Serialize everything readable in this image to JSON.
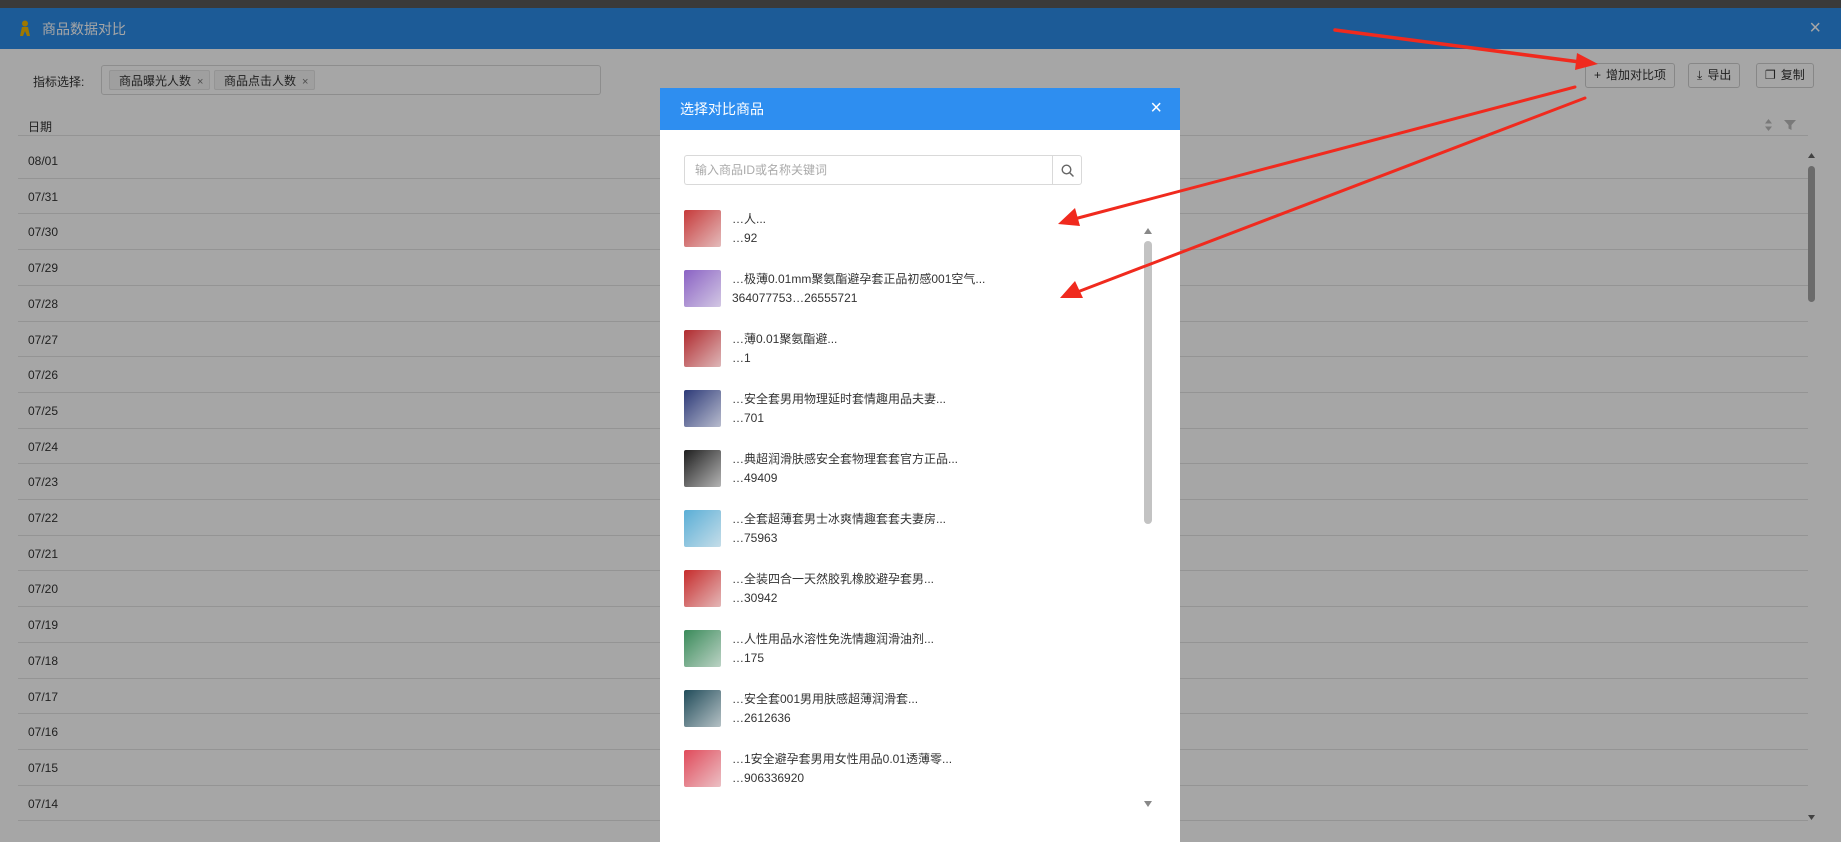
{
  "window": {
    "title": "商品数据对比"
  },
  "filter": {
    "label": "指标选择:",
    "tags": [
      {
        "label": "商品曝光人数",
        "remove": "×"
      },
      {
        "label": "商品点击人数",
        "remove": "×"
      }
    ]
  },
  "toolbar": {
    "add_label": "增加对比项",
    "export_label": "导出",
    "copy_label": "复制"
  },
  "table": {
    "header_date": "日期",
    "dates": [
      "08/01",
      "07/31",
      "07/30",
      "07/29",
      "07/28",
      "07/27",
      "07/26",
      "07/25",
      "07/24",
      "07/23",
      "07/22",
      "07/21",
      "07/20",
      "07/19",
      "07/18",
      "07/17",
      "07/16",
      "07/15",
      "07/14"
    ]
  },
  "modal": {
    "title": "选择对比商品",
    "search_placeholder": "输入商品ID或名称关键词",
    "items": [
      {
        "name": "…人...",
        "id": "…92",
        "thumb_color": "#c63a3a"
      },
      {
        "name": "…极薄0.01mm聚氨酯避孕套正品初感001空气...",
        "id": "364077753…26555721",
        "thumb_color": "#8a62c4"
      },
      {
        "name": "…薄0.01聚氨酯避...",
        "id": "…1",
        "thumb_color": "#b02a2e"
      },
      {
        "name": "…安全套男用物理延时套情趣用品夫妻...",
        "id": "…701",
        "thumb_color": "#2d3a78"
      },
      {
        "name": "…典超润滑肤感安全套物理套套官方正品...",
        "id": "…49409",
        "thumb_color": "#1f1f1f"
      },
      {
        "name": "…全套超薄套男士冰爽情趣套套夫妻房...",
        "id": "…75963",
        "thumb_color": "#5aaed6"
      },
      {
        "name": "…全装四合一天然胶乳橡胶避孕套男...",
        "id": "…30942",
        "thumb_color": "#c62c2c"
      },
      {
        "name": "…人性用品水溶性免洗情趣润滑油剂...",
        "id": "…175",
        "thumb_color": "#3a8a5a"
      },
      {
        "name": "…安全套001男用肤感超薄润滑套...",
        "id": "…2612636",
        "thumb_color": "#214c5a"
      },
      {
        "name": "…1安全避孕套男用女性用品0.01透薄零...",
        "id": "…906336920",
        "thumb_color": "#e04a5a"
      }
    ]
  },
  "colors": {
    "header_blue": "#2c8ce9",
    "modal_header_blue": "#2e8ef0",
    "annotation_red": "#f02a1e"
  }
}
